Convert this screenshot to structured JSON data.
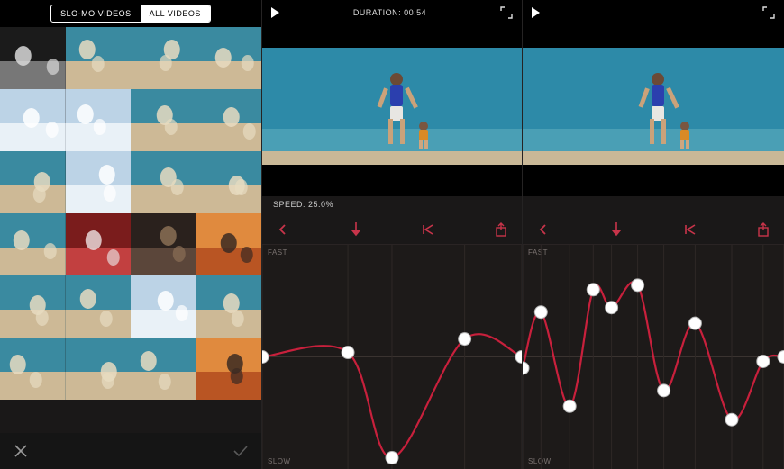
{
  "accent": "#c8344a",
  "gallery": {
    "tabs": [
      {
        "label": "SLO-MO VIDEOS",
        "active": false
      },
      {
        "label": "ALL VIDEOS",
        "active": true
      }
    ],
    "close_icon": "close-icon",
    "confirm_icon": "check-icon",
    "thumbs": [
      "couple-bw",
      "beach-child",
      "couple-closeup",
      "family-beach-walk",
      "selfie-sky",
      "clouds",
      "couple-look",
      "couple-talk",
      "family-shore",
      "clouds-2",
      "man-smile",
      "face-closeup",
      "boy-play",
      "mom-sons-red",
      "xmas-tree",
      "tent-sunset",
      "woman-wind",
      "family-walk-2",
      "sky",
      "dad-carry",
      "couple-shore",
      "beach-stand",
      "dad-piggyback",
      "sunset-silhouette"
    ]
  },
  "editor": {
    "duration_label": "DURATION: 00:54",
    "speed_label": "SPEED: 25.0%",
    "axis_fast": "FAST",
    "axis_slow": "SLOW",
    "toolbar_icons": [
      "back",
      "playhead",
      "to-start",
      "share"
    ],
    "curve_middle": {
      "points": [
        {
          "x": 0.0,
          "y": 0.5
        },
        {
          "x": 0.33,
          "y": 0.48
        },
        {
          "x": 0.5,
          "y": 0.95
        },
        {
          "x": 0.78,
          "y": 0.42
        },
        {
          "x": 1.0,
          "y": 0.5
        }
      ]
    },
    "curve_right": {
      "points": [
        {
          "x": 0.0,
          "y": 0.55
        },
        {
          "x": 0.07,
          "y": 0.3
        },
        {
          "x": 0.18,
          "y": 0.72
        },
        {
          "x": 0.27,
          "y": 0.2
        },
        {
          "x": 0.34,
          "y": 0.28
        },
        {
          "x": 0.44,
          "y": 0.18
        },
        {
          "x": 0.54,
          "y": 0.65
        },
        {
          "x": 0.66,
          "y": 0.35
        },
        {
          "x": 0.8,
          "y": 0.78
        },
        {
          "x": 0.92,
          "y": 0.52
        },
        {
          "x": 1.0,
          "y": 0.5
        }
      ]
    }
  }
}
